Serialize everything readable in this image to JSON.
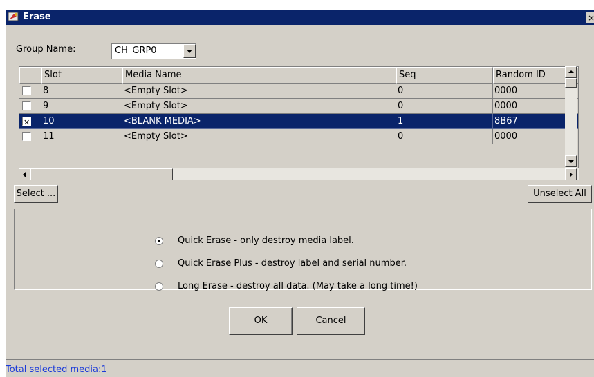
{
  "window": {
    "title": "Erase",
    "close_label": "×"
  },
  "group": {
    "label": "Group Name:",
    "selected": "CH_GRP0"
  },
  "table": {
    "columns": [
      "",
      "Slot",
      "Media Name",
      "Seq",
      "Random ID"
    ],
    "rows": [
      {
        "checked": false,
        "slot": "8",
        "media_name": "<Empty Slot>",
        "seq": "0",
        "random_id": "0000"
      },
      {
        "checked": false,
        "slot": "9",
        "media_name": "<Empty Slot>",
        "seq": "0",
        "random_id": "0000"
      },
      {
        "checked": true,
        "slot": "10",
        "media_name": "<BLANK MEDIA>",
        "seq": "1",
        "random_id": "8B67"
      },
      {
        "checked": false,
        "slot": "11",
        "media_name": "<Empty Slot>",
        "seq": "0",
        "random_id": "0000"
      }
    ]
  },
  "buttons": {
    "select": "Select ...",
    "unselect_all": "Unselect All",
    "ok": "OK",
    "cancel": "Cancel"
  },
  "erase_options": [
    {
      "label": "Quick Erase - only destroy media label.",
      "selected": true
    },
    {
      "label": "Quick Erase Plus - destroy label and serial number.",
      "selected": false
    },
    {
      "label": "Long Erase - destroy all data.  (May take a long time!)",
      "selected": false
    }
  ],
  "status": {
    "text": "Total selected media:1"
  },
  "colors": {
    "title_bar": "#0a246a",
    "selection": "#0a246a",
    "status_text": "#1a3ad9",
    "window_bg": "#d4d0c8"
  }
}
